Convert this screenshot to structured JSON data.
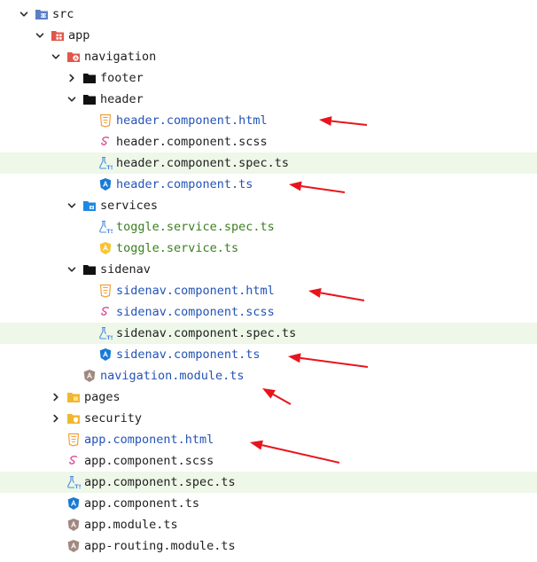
{
  "tree": [
    {
      "label": "src",
      "depth": 0,
      "chevron": "down",
      "icon": "folder-src-icon",
      "color": "dark"
    },
    {
      "label": "app",
      "depth": 1,
      "chevron": "down",
      "icon": "folder-app-icon",
      "color": "dark"
    },
    {
      "label": "navigation",
      "depth": 2,
      "chevron": "down",
      "icon": "folder-angular-icon",
      "color": "dark"
    },
    {
      "label": "footer",
      "depth": 3,
      "chevron": "right",
      "icon": "folder-icon",
      "color": "dark"
    },
    {
      "label": "header",
      "depth": 3,
      "chevron": "down",
      "icon": "folder-icon",
      "color": "dark"
    },
    {
      "label": "header.component.html",
      "depth": 4,
      "chevron": "none",
      "icon": "html-file-icon",
      "color": "blue"
    },
    {
      "label": "header.component.scss",
      "depth": 4,
      "chevron": "none",
      "icon": "scss-file-icon",
      "color": "dark"
    },
    {
      "label": "header.component.spec.ts",
      "depth": 4,
      "chevron": "none",
      "icon": "spec-test-icon",
      "color": "dark",
      "highlighted": true
    },
    {
      "label": "header.component.ts",
      "depth": 4,
      "chevron": "none",
      "icon": "angular-component-icon",
      "color": "blue"
    },
    {
      "label": "services",
      "depth": 3,
      "chevron": "down",
      "icon": "folder-services-icon",
      "color": "dark"
    },
    {
      "label": "toggle.service.spec.ts",
      "depth": 4,
      "chevron": "none",
      "icon": "spec-test-icon",
      "color": "green"
    },
    {
      "label": "toggle.service.ts",
      "depth": 4,
      "chevron": "none",
      "icon": "angular-service-icon",
      "color": "green"
    },
    {
      "label": "sidenav",
      "depth": 3,
      "chevron": "down",
      "icon": "folder-icon",
      "color": "dark"
    },
    {
      "label": "sidenav.component.html",
      "depth": 4,
      "chevron": "none",
      "icon": "html-file-icon",
      "color": "blue"
    },
    {
      "label": "sidenav.component.scss",
      "depth": 4,
      "chevron": "none",
      "icon": "scss-file-icon",
      "color": "blue"
    },
    {
      "label": "sidenav.component.spec.ts",
      "depth": 4,
      "chevron": "none",
      "icon": "spec-test-icon",
      "color": "dark",
      "highlighted": true
    },
    {
      "label": "sidenav.component.ts",
      "depth": 4,
      "chevron": "none",
      "icon": "angular-component-icon",
      "color": "blue"
    },
    {
      "label": "navigation.module.ts",
      "depth": 3,
      "chevron": "none",
      "icon": "angular-module-icon",
      "color": "blue"
    },
    {
      "label": "pages",
      "depth": 2,
      "chevron": "right",
      "icon": "folder-yellow-icon",
      "color": "dark"
    },
    {
      "label": "security",
      "depth": 2,
      "chevron": "right",
      "icon": "folder-security-icon",
      "color": "dark"
    },
    {
      "label": "app.component.html",
      "depth": 2,
      "chevron": "none",
      "icon": "html-file-icon",
      "color": "blue"
    },
    {
      "label": "app.component.scss",
      "depth": 2,
      "chevron": "none",
      "icon": "scss-file-icon",
      "color": "dark"
    },
    {
      "label": "app.component.spec.ts",
      "depth": 2,
      "chevron": "none",
      "icon": "spec-test-icon",
      "color": "dark",
      "highlighted": true
    },
    {
      "label": "app.component.ts",
      "depth": 2,
      "chevron": "none",
      "icon": "angular-component-icon",
      "color": "dark"
    },
    {
      "label": "app.module.ts",
      "depth": 2,
      "chevron": "none",
      "icon": "angular-module-icon",
      "color": "dark"
    },
    {
      "label": "app-routing.module.ts",
      "depth": 2,
      "chevron": "none",
      "icon": "angular-module-icon",
      "color": "dark"
    }
  ],
  "annotation_arrows": [
    {
      "points_to": "header.component.html"
    },
    {
      "points_to": "header.component.ts"
    },
    {
      "points_to": "sidenav.component.html"
    },
    {
      "points_to": "sidenav.component.ts"
    },
    {
      "points_to": "navigation.module.ts"
    },
    {
      "points_to": "app.component.html"
    }
  ],
  "colors": {
    "highlight_row": "#eef7e8",
    "blue_text": "#2353b7",
    "green_text": "#3a7f1e",
    "arrow": "#e8141c"
  }
}
